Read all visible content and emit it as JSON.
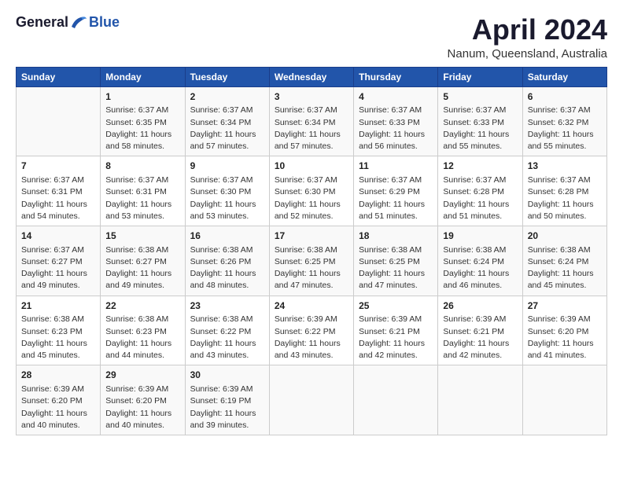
{
  "logo": {
    "general": "General",
    "blue": "Blue"
  },
  "title": "April 2024",
  "location": "Nanum, Queensland, Australia",
  "headers": [
    "Sunday",
    "Monday",
    "Tuesday",
    "Wednesday",
    "Thursday",
    "Friday",
    "Saturday"
  ],
  "weeks": [
    [
      {
        "day": "",
        "info": ""
      },
      {
        "day": "1",
        "info": "Sunrise: 6:37 AM\nSunset: 6:35 PM\nDaylight: 11 hours\nand 58 minutes."
      },
      {
        "day": "2",
        "info": "Sunrise: 6:37 AM\nSunset: 6:34 PM\nDaylight: 11 hours\nand 57 minutes."
      },
      {
        "day": "3",
        "info": "Sunrise: 6:37 AM\nSunset: 6:34 PM\nDaylight: 11 hours\nand 57 minutes."
      },
      {
        "day": "4",
        "info": "Sunrise: 6:37 AM\nSunset: 6:33 PM\nDaylight: 11 hours\nand 56 minutes."
      },
      {
        "day": "5",
        "info": "Sunrise: 6:37 AM\nSunset: 6:33 PM\nDaylight: 11 hours\nand 55 minutes."
      },
      {
        "day": "6",
        "info": "Sunrise: 6:37 AM\nSunset: 6:32 PM\nDaylight: 11 hours\nand 55 minutes."
      }
    ],
    [
      {
        "day": "7",
        "info": "Sunrise: 6:37 AM\nSunset: 6:31 PM\nDaylight: 11 hours\nand 54 minutes."
      },
      {
        "day": "8",
        "info": "Sunrise: 6:37 AM\nSunset: 6:31 PM\nDaylight: 11 hours\nand 53 minutes."
      },
      {
        "day": "9",
        "info": "Sunrise: 6:37 AM\nSunset: 6:30 PM\nDaylight: 11 hours\nand 53 minutes."
      },
      {
        "day": "10",
        "info": "Sunrise: 6:37 AM\nSunset: 6:30 PM\nDaylight: 11 hours\nand 52 minutes."
      },
      {
        "day": "11",
        "info": "Sunrise: 6:37 AM\nSunset: 6:29 PM\nDaylight: 11 hours\nand 51 minutes."
      },
      {
        "day": "12",
        "info": "Sunrise: 6:37 AM\nSunset: 6:28 PM\nDaylight: 11 hours\nand 51 minutes."
      },
      {
        "day": "13",
        "info": "Sunrise: 6:37 AM\nSunset: 6:28 PM\nDaylight: 11 hours\nand 50 minutes."
      }
    ],
    [
      {
        "day": "14",
        "info": "Sunrise: 6:37 AM\nSunset: 6:27 PM\nDaylight: 11 hours\nand 49 minutes."
      },
      {
        "day": "15",
        "info": "Sunrise: 6:38 AM\nSunset: 6:27 PM\nDaylight: 11 hours\nand 49 minutes."
      },
      {
        "day": "16",
        "info": "Sunrise: 6:38 AM\nSunset: 6:26 PM\nDaylight: 11 hours\nand 48 minutes."
      },
      {
        "day": "17",
        "info": "Sunrise: 6:38 AM\nSunset: 6:25 PM\nDaylight: 11 hours\nand 47 minutes."
      },
      {
        "day": "18",
        "info": "Sunrise: 6:38 AM\nSunset: 6:25 PM\nDaylight: 11 hours\nand 47 minutes."
      },
      {
        "day": "19",
        "info": "Sunrise: 6:38 AM\nSunset: 6:24 PM\nDaylight: 11 hours\nand 46 minutes."
      },
      {
        "day": "20",
        "info": "Sunrise: 6:38 AM\nSunset: 6:24 PM\nDaylight: 11 hours\nand 45 minutes."
      }
    ],
    [
      {
        "day": "21",
        "info": "Sunrise: 6:38 AM\nSunset: 6:23 PM\nDaylight: 11 hours\nand 45 minutes."
      },
      {
        "day": "22",
        "info": "Sunrise: 6:38 AM\nSunset: 6:23 PM\nDaylight: 11 hours\nand 44 minutes."
      },
      {
        "day": "23",
        "info": "Sunrise: 6:38 AM\nSunset: 6:22 PM\nDaylight: 11 hours\nand 43 minutes."
      },
      {
        "day": "24",
        "info": "Sunrise: 6:39 AM\nSunset: 6:22 PM\nDaylight: 11 hours\nand 43 minutes."
      },
      {
        "day": "25",
        "info": "Sunrise: 6:39 AM\nSunset: 6:21 PM\nDaylight: 11 hours\nand 42 minutes."
      },
      {
        "day": "26",
        "info": "Sunrise: 6:39 AM\nSunset: 6:21 PM\nDaylight: 11 hours\nand 42 minutes."
      },
      {
        "day": "27",
        "info": "Sunrise: 6:39 AM\nSunset: 6:20 PM\nDaylight: 11 hours\nand 41 minutes."
      }
    ],
    [
      {
        "day": "28",
        "info": "Sunrise: 6:39 AM\nSunset: 6:20 PM\nDaylight: 11 hours\nand 40 minutes."
      },
      {
        "day": "29",
        "info": "Sunrise: 6:39 AM\nSunset: 6:20 PM\nDaylight: 11 hours\nand 40 minutes."
      },
      {
        "day": "30",
        "info": "Sunrise: 6:39 AM\nSunset: 6:19 PM\nDaylight: 11 hours\nand 39 minutes."
      },
      {
        "day": "",
        "info": ""
      },
      {
        "day": "",
        "info": ""
      },
      {
        "day": "",
        "info": ""
      },
      {
        "day": "",
        "info": ""
      }
    ]
  ]
}
